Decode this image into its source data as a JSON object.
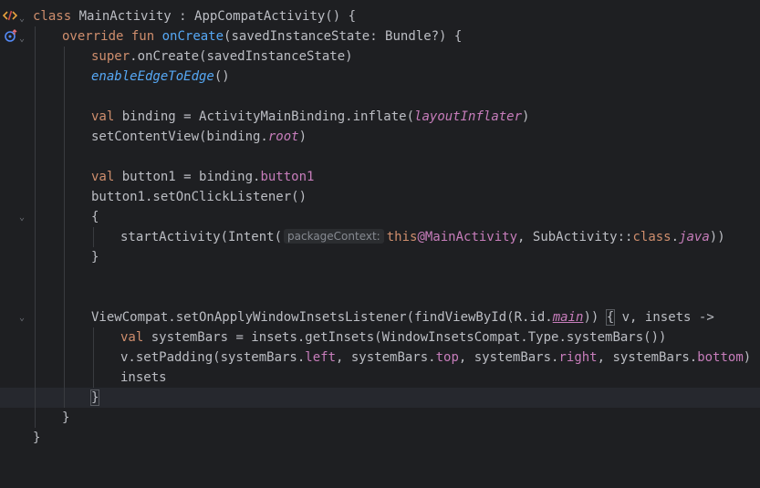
{
  "editor": {
    "lines": [
      {
        "t": "class MainActivity : AppCompatActivity() {"
      },
      {
        "t": "    override fun onCreate(savedInstanceState: Bundle?) {"
      },
      {
        "t": "        super.onCreate(savedInstanceState)"
      },
      {
        "t": "        enableEdgeToEdge()"
      },
      {
        "t": ""
      },
      {
        "t": "        val binding = ActivityMainBinding.inflate(layoutInflater)"
      },
      {
        "t": "        setContentView(binding.root)"
      },
      {
        "t": ""
      },
      {
        "t": "        val button1 = binding.button1"
      },
      {
        "t": "        button1.setOnClickListener()"
      },
      {
        "t": "        {"
      },
      {
        "t": "            startActivity(Intent(packageContext: this@MainActivity, SubActivity::class.java))"
      },
      {
        "t": "        }"
      },
      {
        "t": ""
      },
      {
        "t": ""
      },
      {
        "t": "        ViewCompat.setOnApplyWindowInsetsListener(findViewById(R.id.main)) { v, insets ->"
      },
      {
        "t": "            val systemBars = insets.getInsets(WindowInsetsCompat.Type.systemBars())"
      },
      {
        "t": "            v.setPadding(systemBars.left, systemBars.top, systemBars.right, systemBars.bottom)"
      },
      {
        "t": "            insets"
      },
      {
        "t": "        }"
      },
      {
        "t": "    }"
      },
      {
        "t": "}"
      }
    ],
    "tokens": {
      "l0": [
        "class",
        " MainActivity : AppCompatActivity() {"
      ],
      "l1": [
        "override",
        " ",
        "fun",
        " ",
        "onCreate",
        "(savedInstanceState: Bundle?) {"
      ],
      "l2": [
        "super",
        ".onCreate(savedInstanceState)"
      ],
      "l3": [
        "enableEdgeToEdge",
        "()"
      ],
      "l5": [
        "val",
        " binding = ActivityMainBinding.inflate(",
        "layoutInflater",
        ")"
      ],
      "l6": [
        "setContentView(binding.",
        "root",
        ")"
      ],
      "l8": [
        "val",
        " button1 = binding.",
        "button1"
      ],
      "l9": [
        "button1.setOnClickListener()"
      ],
      "l10": [
        "{"
      ],
      "l11": [
        "startActivity(Intent(",
        "packageContext:",
        "this",
        "@MainActivity",
        ", SubActivity::",
        "class",
        ".",
        "java",
        "))"
      ],
      "l12": [
        "}"
      ],
      "l15": [
        "ViewCompat.setOnApplyWindowInsetsListener(findViewById(R.id.",
        "main",
        ")) ",
        "{",
        " v, insets ->"
      ],
      "l16": [
        "val",
        " systemBars = insets.getInsets(WindowInsetsCompat.Type.systemBars())"
      ],
      "l17": [
        "v.setPadding(systemBars.",
        "left",
        ", systemBars.",
        "top",
        ", systemBars.",
        "right",
        ", systemBars.",
        "bottom",
        ")"
      ],
      "l18": [
        "insets"
      ],
      "l19": [
        "}"
      ],
      "l20": [
        "}"
      ],
      "l21": [
        "}"
      ]
    },
    "gutter_icons": {
      "class_icon": "code-tag-icon",
      "override_icon": "override-method-icon",
      "fold_icon": "chevron-down-icon",
      "intention_icon": "lightbulb-icon"
    },
    "colors": {
      "background": "#1e1f22",
      "text": "#bcbec4",
      "keyword": "#cf8e6d",
      "function": "#56a8f5",
      "property": "#c77dbb",
      "current_line": "#26282e"
    }
  }
}
